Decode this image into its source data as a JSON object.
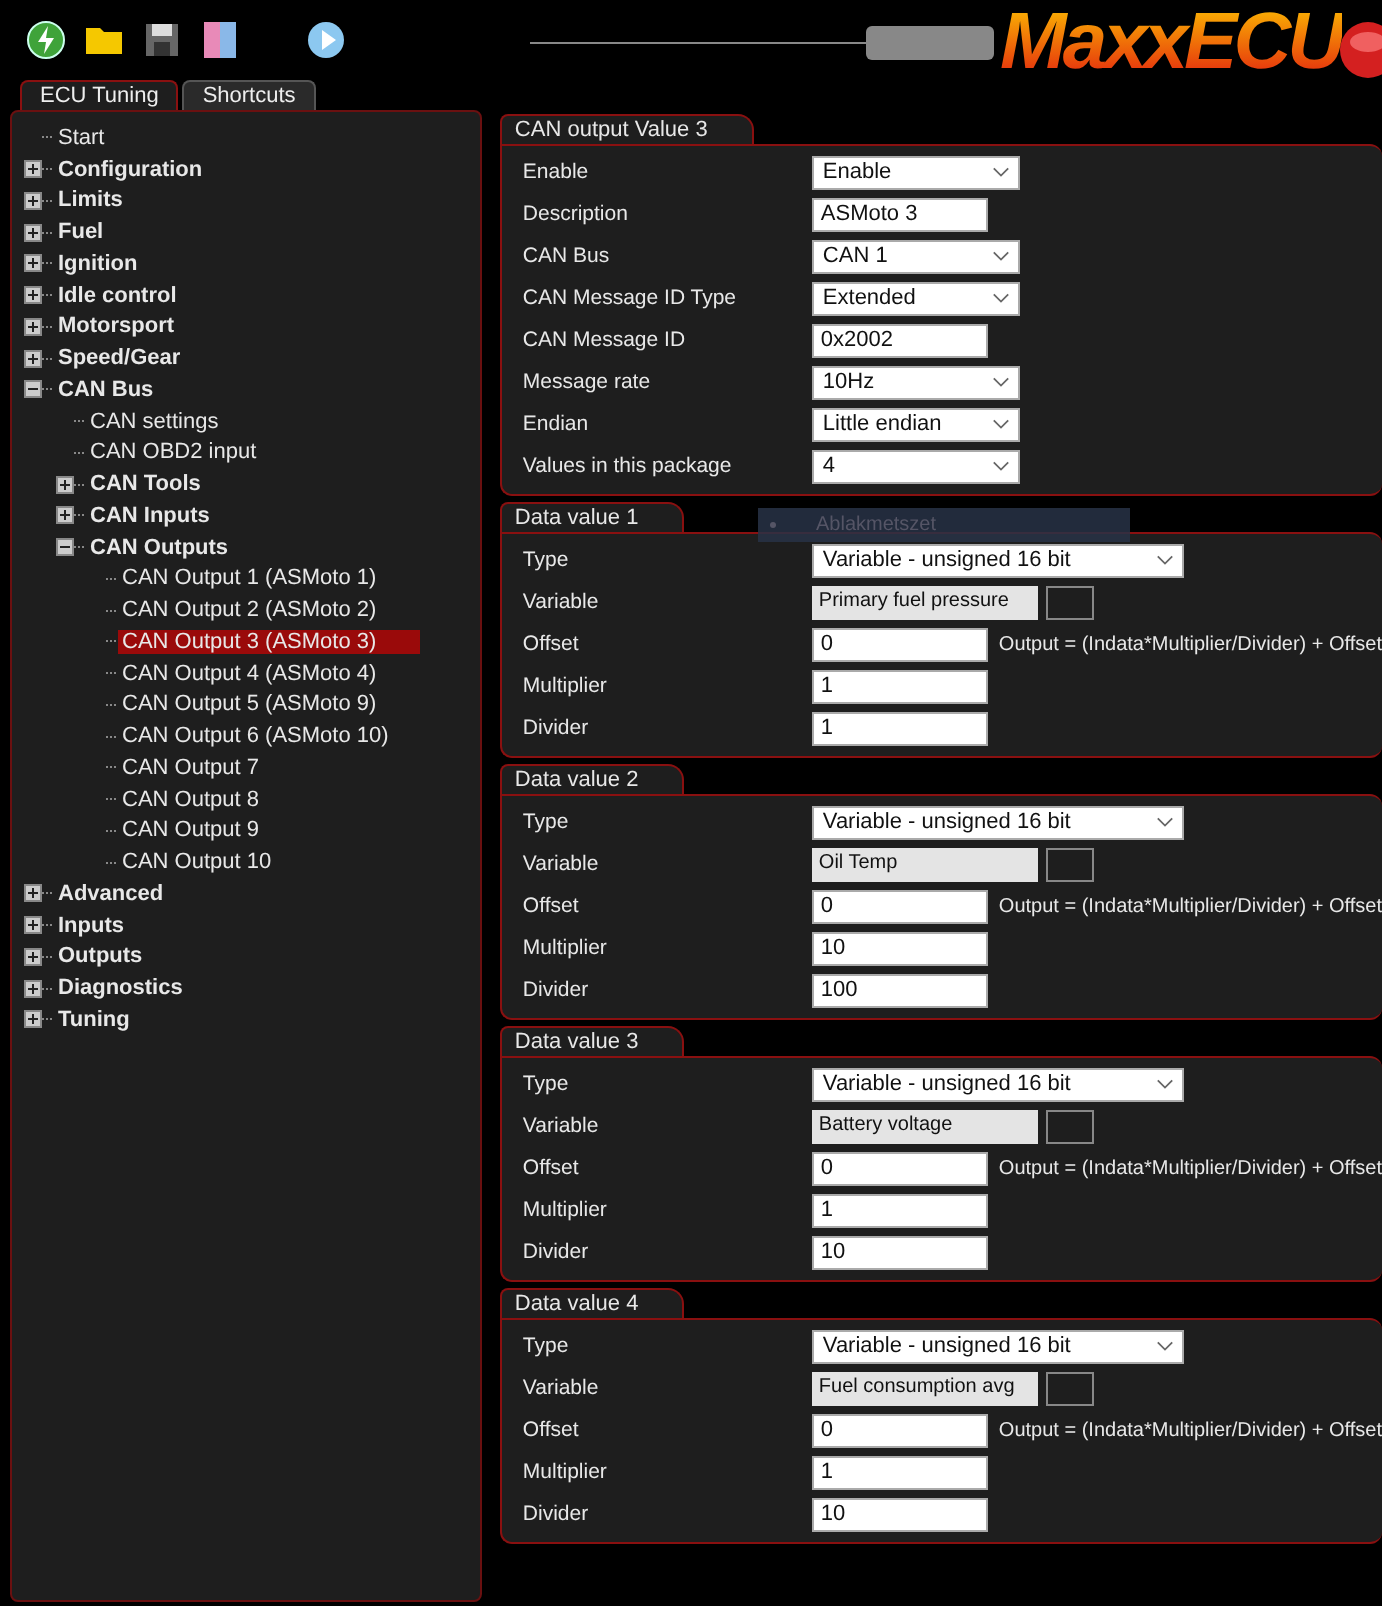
{
  "toolbar": {
    "slider": {
      "level": 1
    },
    "logo": "MaxxECU"
  },
  "tabs": [
    {
      "label": "ECU Tuning",
      "selected": true
    },
    {
      "label": "Shortcuts",
      "selected": false
    }
  ],
  "tree": [
    {
      "label": "Start",
      "kind": "leaf",
      "selected": false
    },
    {
      "label": "Configuration",
      "kind": "group",
      "expanded": false
    },
    {
      "label": "Limits",
      "kind": "group",
      "expanded": false
    },
    {
      "label": "Fuel",
      "kind": "group",
      "expanded": false
    },
    {
      "label": "Ignition",
      "kind": "group",
      "expanded": false
    },
    {
      "label": "Idle control",
      "kind": "group",
      "expanded": false
    },
    {
      "label": "Motorsport",
      "kind": "group",
      "expanded": false
    },
    {
      "label": "Speed/Gear",
      "kind": "group",
      "expanded": false
    },
    {
      "label": "CAN Bus",
      "kind": "group",
      "expanded": true,
      "children": [
        {
          "label": "CAN settings",
          "kind": "leaf",
          "selected": false
        },
        {
          "label": "CAN OBD2 input",
          "kind": "leaf",
          "selected": false
        },
        {
          "label": "CAN Tools",
          "kind": "group",
          "expanded": false
        },
        {
          "label": "CAN Inputs",
          "kind": "group",
          "expanded": false
        },
        {
          "label": "CAN Outputs",
          "kind": "group",
          "expanded": true,
          "children": [
            {
              "label": "CAN Output 1 (ASMoto 1)",
              "kind": "leaf",
              "selected": false
            },
            {
              "label": "CAN Output 2 (ASMoto 2)",
              "kind": "leaf",
              "selected": false
            },
            {
              "label": "CAN Output 3 (ASMoto 3)",
              "kind": "leaf",
              "selected": true
            },
            {
              "label": "CAN Output 4 (ASMoto 4)",
              "kind": "leaf",
              "selected": false
            },
            {
              "label": "CAN Output 5 (ASMoto 9)",
              "kind": "leaf",
              "selected": false
            },
            {
              "label": "CAN Output 6 (ASMoto 10)",
              "kind": "leaf",
              "selected": false
            },
            {
              "label": "CAN Output 7",
              "kind": "leaf",
              "selected": false
            },
            {
              "label": "CAN Output 8",
              "kind": "leaf",
              "selected": false
            },
            {
              "label": "CAN Output 9",
              "kind": "leaf",
              "selected": false
            },
            {
              "label": "CAN Output 10",
              "kind": "leaf",
              "selected": false
            }
          ]
        }
      ]
    },
    {
      "label": "Advanced",
      "kind": "group",
      "expanded": false
    },
    {
      "label": "Inputs",
      "kind": "group",
      "expanded": false
    },
    {
      "label": "Outputs",
      "kind": "group",
      "expanded": false
    },
    {
      "label": "Diagnostics",
      "kind": "group",
      "expanded": false
    },
    {
      "label": "Tuning",
      "kind": "group",
      "expanded": false
    }
  ],
  "tooltip": {
    "text": "Ablakmetszet"
  },
  "groups": [
    {
      "title": "CAN output Value 3",
      "rows": [
        {
          "label": "Enable",
          "kind": "select",
          "value": "Enable"
        },
        {
          "label": "Description",
          "kind": "text",
          "value": "ASMoto 3"
        },
        {
          "label": "CAN Bus",
          "kind": "select",
          "value": "CAN 1"
        },
        {
          "label": "CAN Message ID Type",
          "kind": "select",
          "value": "Extended"
        },
        {
          "label": "CAN Message ID",
          "kind": "text",
          "value": "0x2002"
        },
        {
          "label": "Message rate",
          "kind": "select",
          "value": "10Hz"
        },
        {
          "label": "Endian",
          "kind": "select",
          "value": "Little endian"
        },
        {
          "label": "Values in this package",
          "kind": "select",
          "value": "4"
        }
      ]
    },
    {
      "title": "Data value 1",
      "rows": [
        {
          "label": "Type",
          "kind": "long-select",
          "value": "Variable - unsigned 16 bit"
        },
        {
          "label": "Variable",
          "kind": "picker",
          "value": "Primary fuel pressure"
        },
        {
          "label": "Offset",
          "kind": "text",
          "value": "0",
          "note": "Output = (Indata*Multiplier/Divider) + Offset"
        },
        {
          "label": "Multiplier",
          "kind": "text",
          "value": "1"
        },
        {
          "label": "Divider",
          "kind": "text",
          "value": "1"
        }
      ]
    },
    {
      "title": "Data value 2",
      "rows": [
        {
          "label": "Type",
          "kind": "long-select",
          "value": "Variable - unsigned 16 bit"
        },
        {
          "label": "Variable",
          "kind": "picker",
          "value": "Oil Temp"
        },
        {
          "label": "Offset",
          "kind": "text",
          "value": "0",
          "note": "Output = (Indata*Multiplier/Divider) + Offset"
        },
        {
          "label": "Multiplier",
          "kind": "text",
          "value": "10"
        },
        {
          "label": "Divider",
          "kind": "text",
          "value": "100"
        }
      ]
    },
    {
      "title": "Data value 3",
      "rows": [
        {
          "label": "Type",
          "kind": "long-select",
          "value": "Variable - unsigned 16 bit"
        },
        {
          "label": "Variable",
          "kind": "picker",
          "value": "Battery voltage"
        },
        {
          "label": "Offset",
          "kind": "text",
          "value": "0",
          "note": "Output = (Indata*Multiplier/Divider) + Offset"
        },
        {
          "label": "Multiplier",
          "kind": "text",
          "value": "1"
        },
        {
          "label": "Divider",
          "kind": "text",
          "value": "10"
        }
      ]
    },
    {
      "title": "Data value 4",
      "rows": [
        {
          "label": "Type",
          "kind": "long-select",
          "value": "Variable - unsigned 16 bit"
        },
        {
          "label": "Variable",
          "kind": "picker",
          "value": "Fuel consumption avg"
        },
        {
          "label": "Offset",
          "kind": "text",
          "value": "0",
          "note": "Output = (Indata*Multiplier/Divider) + Offset"
        },
        {
          "label": "Multiplier",
          "kind": "text",
          "value": "1"
        },
        {
          "label": "Divider",
          "kind": "text",
          "value": "10"
        }
      ]
    }
  ]
}
